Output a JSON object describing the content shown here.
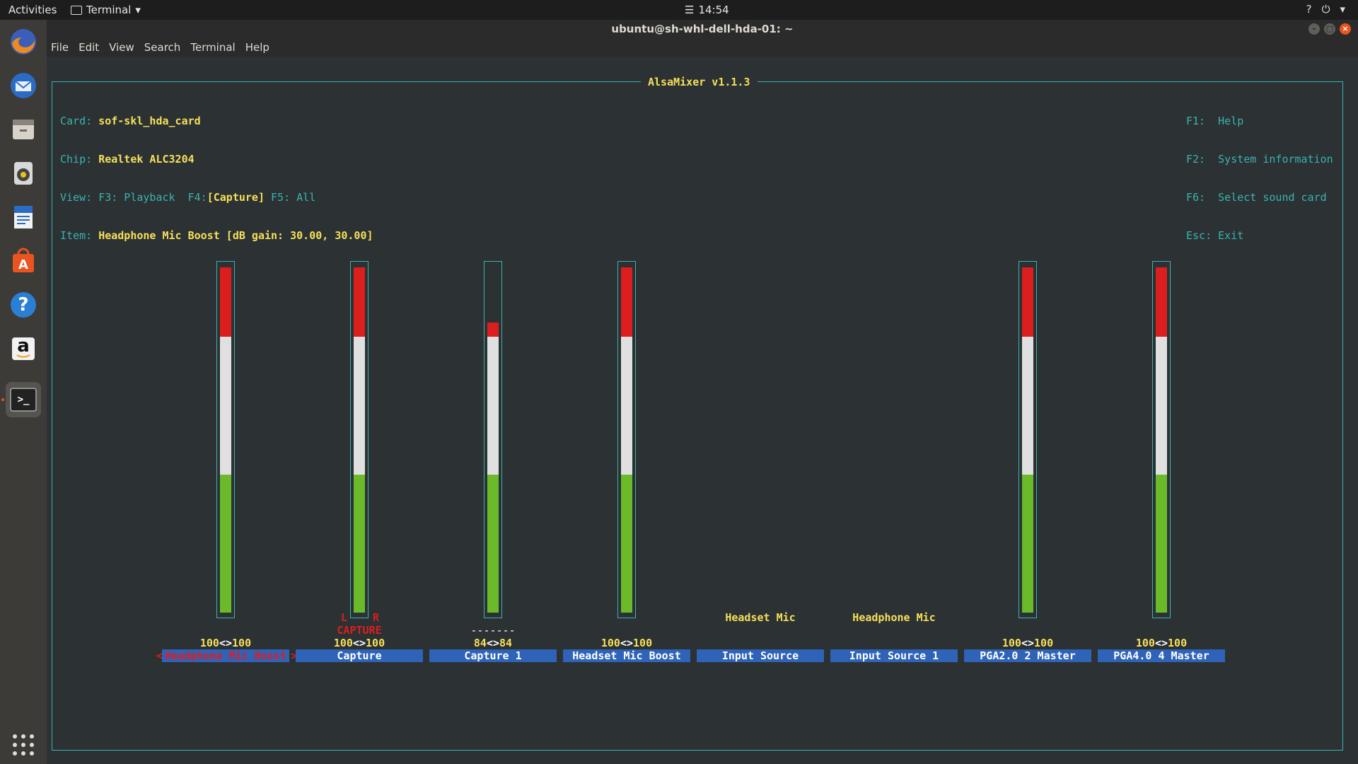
{
  "topbar": {
    "activities": "Activities",
    "app_name": "Terminal",
    "app_arrow": "▾",
    "clock_icon": "☰",
    "time": "14:54",
    "tray_icons": [
      "?",
      "⏻",
      "▾"
    ]
  },
  "dock": {
    "items": [
      "firefox-icon",
      "thunderbird-icon",
      "files-icon",
      "rhythmbox-icon",
      "writer-icon",
      "software-center-icon",
      "help-icon",
      "amazon-icon",
      "terminal-icon"
    ],
    "help_glyph": "?",
    "amazon_glyph": "a",
    "terminal_glyph": ">_"
  },
  "window": {
    "title": "ubuntu@sh-whl-dell-hda-01: ~",
    "menu": [
      "File",
      "Edit",
      "View",
      "Search",
      "Terminal",
      "Help"
    ]
  },
  "alsamixer": {
    "title": "AlsaMixer v1.1.3",
    "card_label": "Card:",
    "card": "sof-skl_hda_card",
    "chip_label": "Chip:",
    "chip": "Realtek ALC3204",
    "view_label": "View:",
    "view_f3": "F3: Playback",
    "view_f4_key": "F4:",
    "view_f4": "[Capture]",
    "view_f5": "F5: All",
    "item_label": "Item:",
    "item": "Headphone Mic Boost [dB gain: 30.00, 30.00]",
    "keys": [
      {
        "key": "F1:",
        "text": "Help"
      },
      {
        "key": "F2:",
        "text": "System information"
      },
      {
        "key": "F6:",
        "text": "Select sound card"
      },
      {
        "key": "Esc:",
        "text": "Exit"
      }
    ],
    "controls": [
      {
        "name": "Headphone Mic Boost",
        "volume_l": "100",
        "volume_r": "100",
        "level": 1.0,
        "selected": true
      },
      {
        "name": "Capture",
        "volume_l": "100",
        "volume_r": "100",
        "level": 1.0,
        "capture_l": "L",
        "capture_r": "R",
        "capture_text": "CAPTURE"
      },
      {
        "name": "Capture 1",
        "volume_l": "84",
        "volume_r": "84",
        "level": 0.84,
        "nocapture": "-------"
      },
      {
        "name": "Headset Mic Boost",
        "volume_l": "100",
        "volume_r": "100",
        "level": 1.0
      },
      {
        "name": "Input Source",
        "enum_value": "Headset Mic"
      },
      {
        "name": "Input Source 1",
        "enum_value": "Headphone Mic"
      },
      {
        "name": "PGA2.0 2 Master",
        "volume_l": "100",
        "volume_r": "100",
        "level": 1.0
      },
      {
        "name": "PGA4.0 4 Master",
        "volume_l": "100",
        "volume_r": "100",
        "level": 1.0
      }
    ],
    "selected_left_arrow": "<",
    "selected_right_arrow": ">",
    "vol_sep": "<>"
  }
}
